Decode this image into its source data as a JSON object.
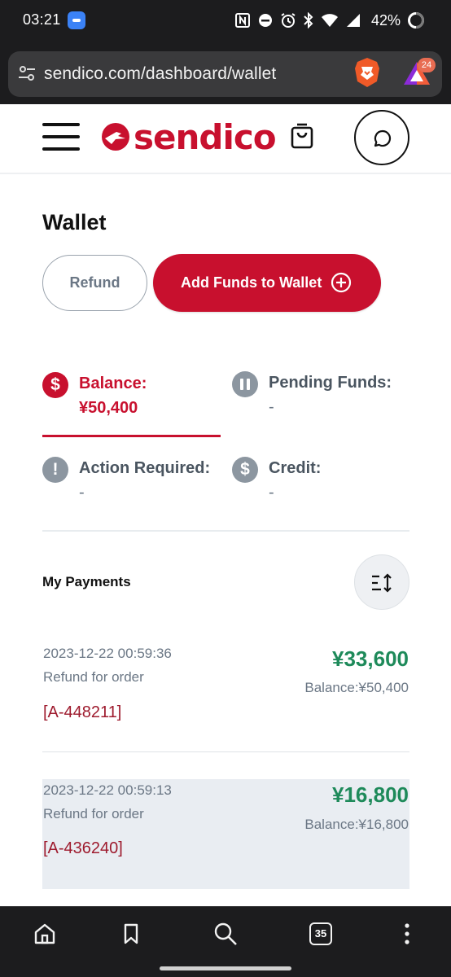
{
  "status_bar": {
    "time": "03:21",
    "battery_percent": "42%"
  },
  "browser": {
    "url": "sendico.com/dashboard/wallet",
    "rewards_badge_count": "24",
    "tab_count": "35"
  },
  "header": {
    "logo_text": "sendico"
  },
  "wallet": {
    "title": "Wallet",
    "refund_button": "Refund",
    "add_funds_button": "Add Funds to Wallet",
    "stats": {
      "balance_label": "Balance:",
      "balance_value": "¥50,400",
      "pending_label": "Pending Funds:",
      "pending_value": "-",
      "action_label": "Action Required:",
      "action_value": "-",
      "credit_label": "Credit:",
      "credit_value": "-"
    }
  },
  "payments": {
    "section_title": "My Payments",
    "items": [
      {
        "datetime": "2023-12-22 00:59:36",
        "description": "Refund for order",
        "reference": "[A-448211]",
        "amount": "¥33,600",
        "balance": "Balance:¥50,400"
      },
      {
        "datetime": "2023-12-22 00:59:13",
        "description": "Refund for order",
        "reference": "[A-436240]",
        "amount": "¥16,800",
        "balance": "Balance:¥16,800"
      }
    ]
  },
  "icons": {
    "stat_balance": "$",
    "stat_action": "!",
    "stat_credit": "$"
  },
  "colors": {
    "brand_red": "#c8102e",
    "amount_green": "#1e8a5a",
    "muted_grey": "#6b7785",
    "dark_chrome": "#1c1c1e"
  }
}
